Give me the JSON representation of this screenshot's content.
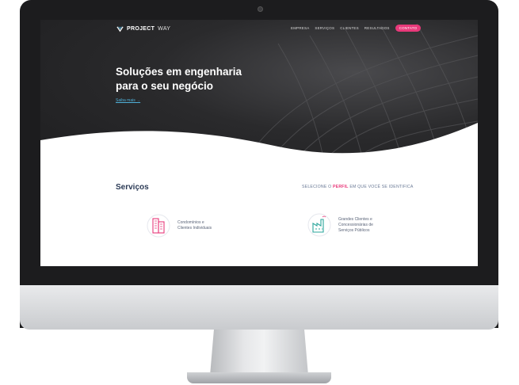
{
  "brand": {
    "strong": "PROJECT",
    "light": "WAY"
  },
  "nav": {
    "items": [
      "EMPRESA",
      "SERVIÇOS",
      "CLIENTES",
      "RESULTADOS"
    ],
    "contact": "CONTATO"
  },
  "hero": {
    "line1": "Soluções em engenharia",
    "line2": "para o seu negócio",
    "link": "Saiba mais →"
  },
  "services": {
    "title": "Serviços",
    "select_prefix": "SELECIONE O ",
    "select_highlight": "PERFIL",
    "select_suffix": " EM QUE VOCÊ SE IDENTIFICA",
    "cards": [
      {
        "line1": "Condomínios e",
        "line2": "Clientes Individuais",
        "icon": "buildings-icon"
      },
      {
        "line1": "Grandes Clientes e",
        "line2": "Concessionárias de",
        "line3": "Serviços Públicos",
        "icon": "factory-icon"
      }
    ]
  },
  "colors": {
    "accent": "#e8397a",
    "link": "#4fb0d8",
    "title": "#2b3a55",
    "hero_dark": "#1e1e20"
  }
}
